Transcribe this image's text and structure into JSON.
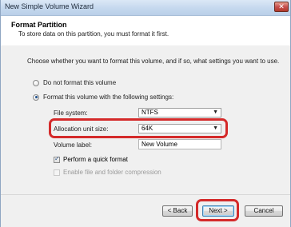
{
  "window": {
    "title": "New Simple Volume Wizard",
    "close_symbol": "✕"
  },
  "header": {
    "title": "Format Partition",
    "subtitle": "To store data on this partition, you must format it first."
  },
  "instructions": "Choose whether you want to format this volume, and if so, what settings you want to use.",
  "format_options": {
    "do_not_format_label": "Do not format this volume",
    "format_label": "Format this volume with the following settings:",
    "selected": "format"
  },
  "settings": {
    "file_system_label": "File system:",
    "file_system_value": "NTFS",
    "allocation_label": "Allocation unit size:",
    "allocation_value": "64K",
    "volume_label_label": "Volume label:",
    "volume_label_value": "New Volume"
  },
  "checkboxes": {
    "quick_format_label": "Perform a quick format",
    "quick_format_checked": true,
    "compression_label": "Enable file and folder compression",
    "compression_checked": false,
    "compression_enabled": false
  },
  "buttons": {
    "back": "< Back",
    "next": "Next >",
    "cancel": "Cancel"
  },
  "colors": {
    "highlight": "#d42a2a"
  }
}
